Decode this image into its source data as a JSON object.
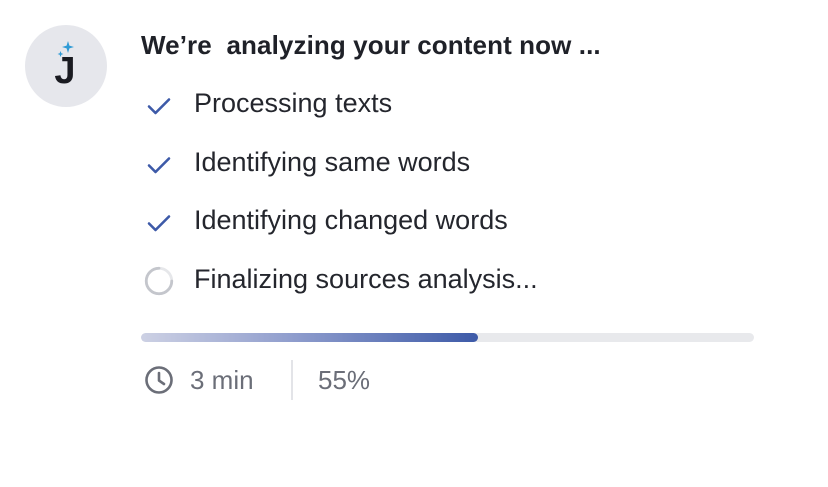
{
  "avatar": {
    "letter": "J"
  },
  "title": "We’re  analyzing your content now ...",
  "steps": [
    {
      "label": "Processing texts",
      "status": "done",
      "icon": "check-icon"
    },
    {
      "label": "Identifying same words",
      "status": "done",
      "icon": "check-icon"
    },
    {
      "label": "Identifying changed words",
      "status": "done",
      "icon": "check-icon"
    },
    {
      "label": "Finalizing sources analysis...",
      "status": "in-progress",
      "icon": "spinner-icon"
    }
  ],
  "progress": {
    "value": 0.55
  },
  "meta": {
    "time": "3 min",
    "percent": "55%",
    "icon": "clock-icon"
  },
  "colors": {
    "accent": "#3d5aa8",
    "check": "#3d5aa8",
    "sparkle": "#2f9bd6",
    "muted_text": "#6b6e78",
    "track": "#e8e9ec"
  }
}
